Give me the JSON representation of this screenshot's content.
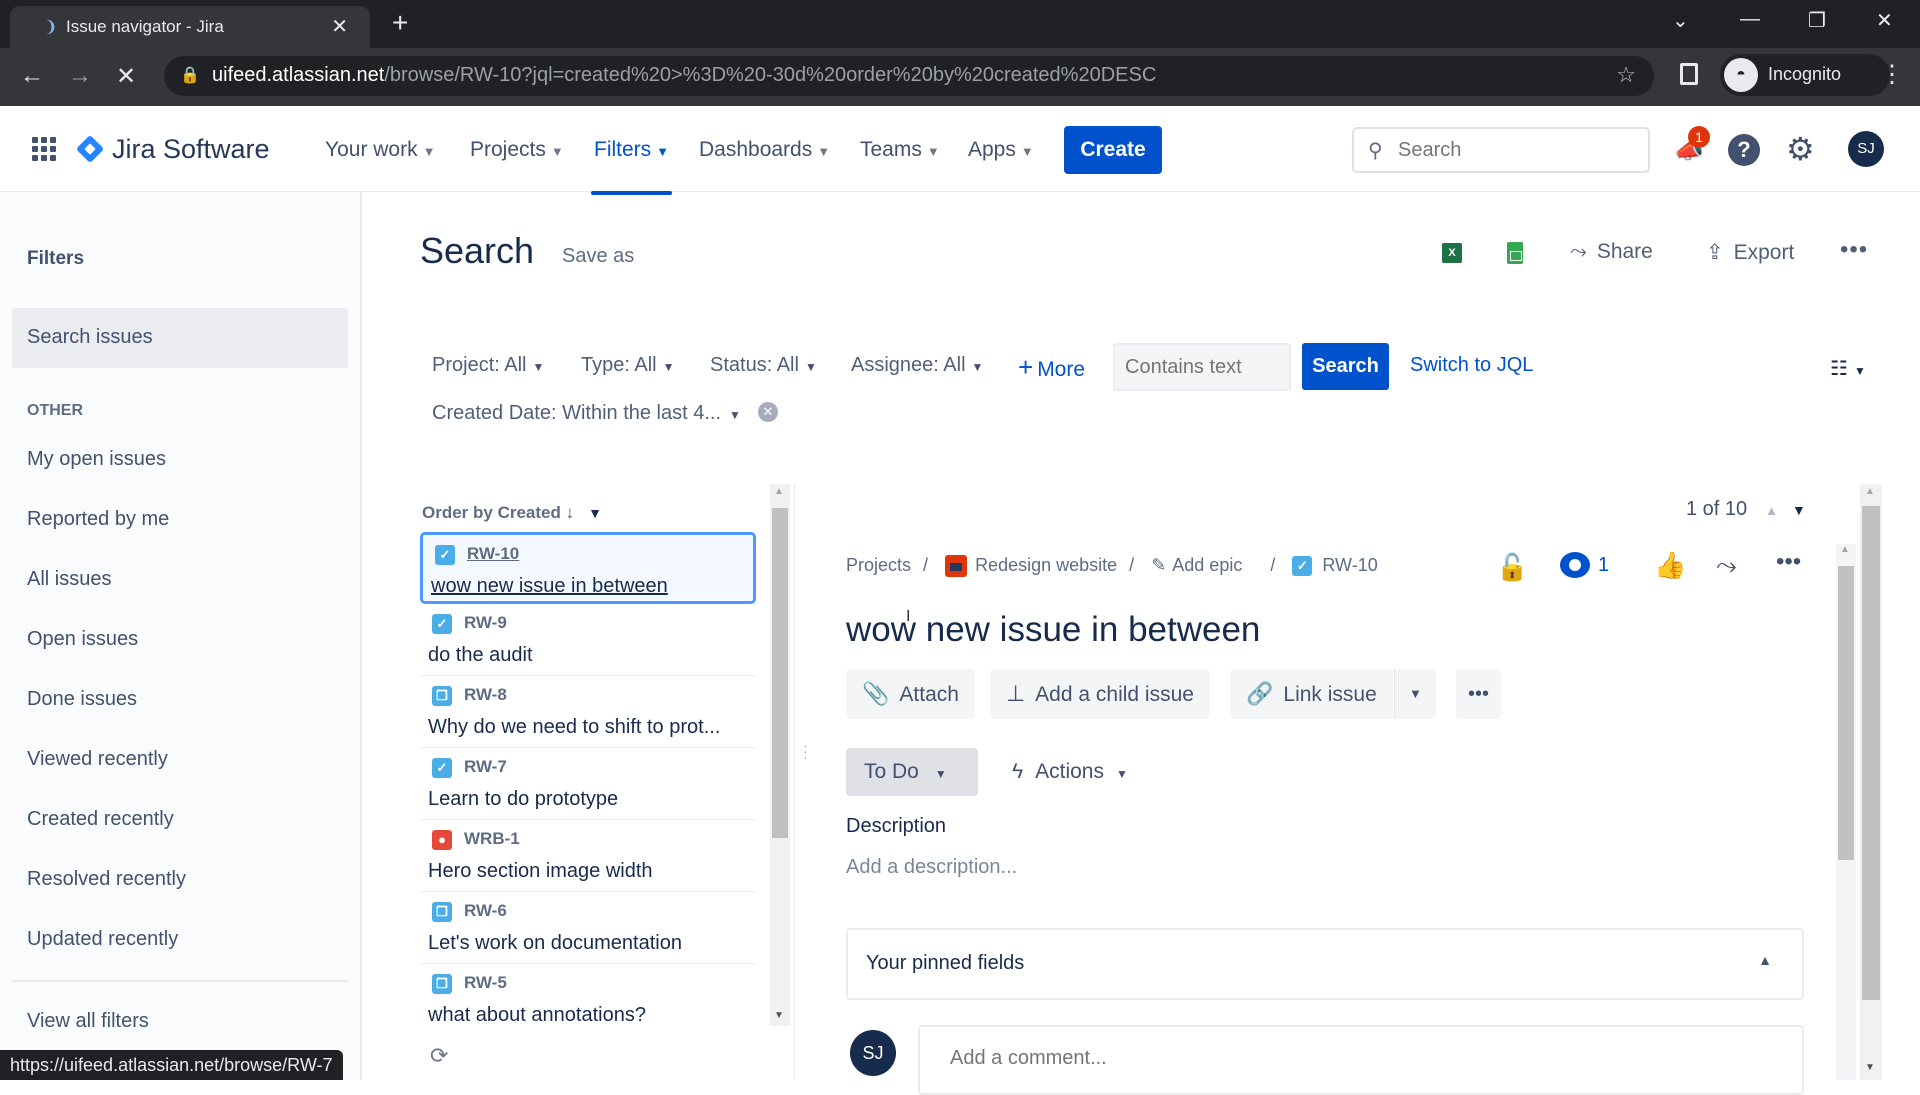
{
  "browser": {
    "tab_title": "Issue navigator - Jira",
    "new_tab_icon": "plus-icon",
    "url_host": "uifeed.atlassian.net",
    "url_path": "/browse/RW-10?jql=created%20>%3D%20-30d%20order%20by%20created%20DESC",
    "profile_label": "Incognito",
    "status_url": "https://uifeed.atlassian.net/browse/RW-7"
  },
  "topnav": {
    "product_name": "Jira Software",
    "items": [
      {
        "label": "Your work",
        "active": false
      },
      {
        "label": "Projects",
        "active": false
      },
      {
        "label": "Filters",
        "active": true
      },
      {
        "label": "Dashboards",
        "active": false
      },
      {
        "label": "Teams",
        "active": false
      },
      {
        "label": "Apps",
        "active": false
      }
    ],
    "create_label": "Create",
    "search_placeholder": "Search",
    "notification_count": "1",
    "user_initials": "SJ"
  },
  "sidebar": {
    "title": "Filters",
    "selected_item": "Search issues",
    "section_label": "OTHER",
    "items": [
      "My open issues",
      "Reported by me",
      "All issues",
      "Open issues",
      "Done issues",
      "Viewed recently",
      "Created recently",
      "Resolved recently",
      "Updated recently"
    ],
    "view_all": "View all filters"
  },
  "header": {
    "title": "Search",
    "save_as": "Save as",
    "share": "Share",
    "export": "Export"
  },
  "filters": {
    "project": "Project: All",
    "type": "Type: All",
    "status": "Status: All",
    "assignee": "Assignee: All",
    "more": "More",
    "text_placeholder": "Contains text",
    "search_button": "Search",
    "switch_jql": "Switch to JQL",
    "created_date": "Created Date: Within the last 4..."
  },
  "issue_list": {
    "order_label": "Order by Created",
    "issues": [
      {
        "key": "RW-10",
        "summary": "wow new issue in between",
        "type": "task",
        "selected": true
      },
      {
        "key": "RW-9",
        "summary": "do the audit",
        "type": "task",
        "selected": false
      },
      {
        "key": "RW-8",
        "summary": "Why do we need to shift to prot...",
        "type": "subtask",
        "selected": false
      },
      {
        "key": "RW-7",
        "summary": "Learn to do prototype",
        "type": "task",
        "selected": false
      },
      {
        "key": "WRB-1",
        "summary": "Hero section image width",
        "type": "bug",
        "selected": false
      },
      {
        "key": "RW-6",
        "summary": "Let's work on documentation",
        "type": "subtask",
        "selected": false
      },
      {
        "key": "RW-5",
        "summary": "what about annotations?",
        "type": "subtask",
        "selected": false
      }
    ]
  },
  "detail": {
    "counter": "1 of 10",
    "breadcrumb": {
      "projects": "Projects",
      "project_name": "Redesign website",
      "epic": "Add epic",
      "issue_key": "RW-10"
    },
    "watchers": "1",
    "title": "wow new issue in between",
    "actions": {
      "attach": "Attach",
      "add_child": "Add a child issue",
      "link_issue": "Link issue"
    },
    "status": "To Do",
    "actions_menu": "Actions",
    "description_label": "Description",
    "description_placeholder": "Add a description...",
    "pinned_fields": "Your pinned fields",
    "comment_placeholder": "Add a comment...",
    "commenter_initials": "SJ"
  },
  "colors": {
    "brand": "#0052cc",
    "task": "#4bade8",
    "bug": "#e5493a",
    "badge": "#de350b"
  }
}
